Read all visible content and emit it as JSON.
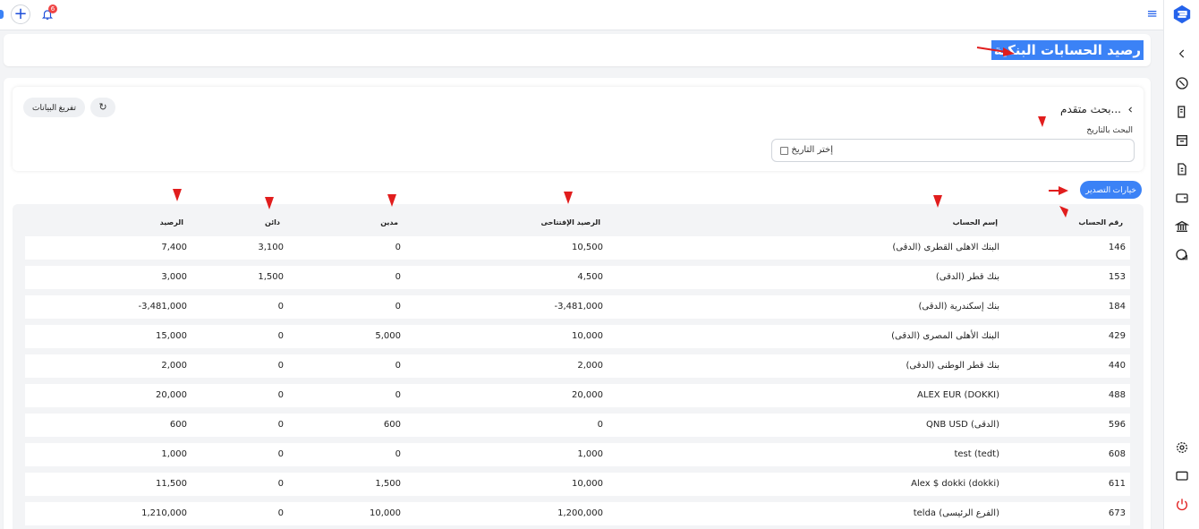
{
  "topbar": {
    "plus_label": "+",
    "notification_count": "6",
    "menu_glyph": "≡"
  },
  "header": {
    "title": "رصيد الحسابات البنكية"
  },
  "search": {
    "advanced_label": "بحث متقدم...",
    "date_label": "البحث بالتاريخ",
    "date_placeholder": "إختر التاريخ"
  },
  "toolbar": {
    "clear_label": "تفريغ البيانات",
    "refresh_glyph": "↻",
    "export_label": "خيارات التصدير"
  },
  "table": {
    "columns": {
      "account_no": "رقم الحساب",
      "account_name": "إسم الحساب",
      "opening_balance": "الرصيد الإفتتاحى",
      "debit": "مدين",
      "credit": "دائن",
      "balance": "الرصيد"
    },
    "rows": [
      {
        "account_no": "146",
        "account_name": "البنك الاهلى القطرى (الدقى)",
        "opening_balance": "10,500",
        "debit": "0",
        "credit": "3,100",
        "balance": "7,400"
      },
      {
        "account_no": "153",
        "account_name": "بنك قطر (الدقى)",
        "opening_balance": "4,500",
        "debit": "0",
        "credit": "1,500",
        "balance": "3,000"
      },
      {
        "account_no": "184",
        "account_name": "بنك إسكندرية (الدقى)",
        "opening_balance": "-3,481,000",
        "debit": "0",
        "credit": "0",
        "balance": "-3,481,000"
      },
      {
        "account_no": "429",
        "account_name": "البنك الأهلى المصرى (الدقى)",
        "opening_balance": "10,000",
        "debit": "5,000",
        "credit": "0",
        "balance": "15,000"
      },
      {
        "account_no": "440",
        "account_name": "بنك قطر الوطنى (الدقى)",
        "opening_balance": "2,000",
        "debit": "0",
        "credit": "0",
        "balance": "2,000"
      },
      {
        "account_no": "488",
        "account_name": "ALEX EUR (DOKKI)",
        "opening_balance": "20,000",
        "debit": "0",
        "credit": "0",
        "balance": "20,000"
      },
      {
        "account_no": "596",
        "account_name": "QNB USD (الدقى)",
        "opening_balance": "0",
        "debit": "600",
        "credit": "0",
        "balance": "600"
      },
      {
        "account_no": "608",
        "account_name": "test (tedt)",
        "opening_balance": "1,000",
        "debit": "0",
        "credit": "0",
        "balance": "1,000"
      },
      {
        "account_no": "611",
        "account_name": "Alex $ dokki (dokki)",
        "opening_balance": "10,000",
        "debit": "1,500",
        "credit": "0",
        "balance": "11,500"
      },
      {
        "account_no": "673",
        "account_name": "telda (الفرع الرئيسى)",
        "opening_balance": "1,200,000",
        "debit": "10,000",
        "credit": "0",
        "balance": "1,210,000"
      }
    ]
  },
  "sidebar": {
    "icons": [
      "chevron-left-icon",
      "gauge-icon",
      "printer-icon",
      "invoice-icon",
      "document-money-icon",
      "wallet-icon",
      "bank-icon",
      "report-icon",
      "settings-icon",
      "monitor-icon",
      "power-icon"
    ]
  },
  "colors": {
    "accent": "#3b82f6",
    "annotation": "#e11d1d",
    "power": "#e11d1d"
  }
}
